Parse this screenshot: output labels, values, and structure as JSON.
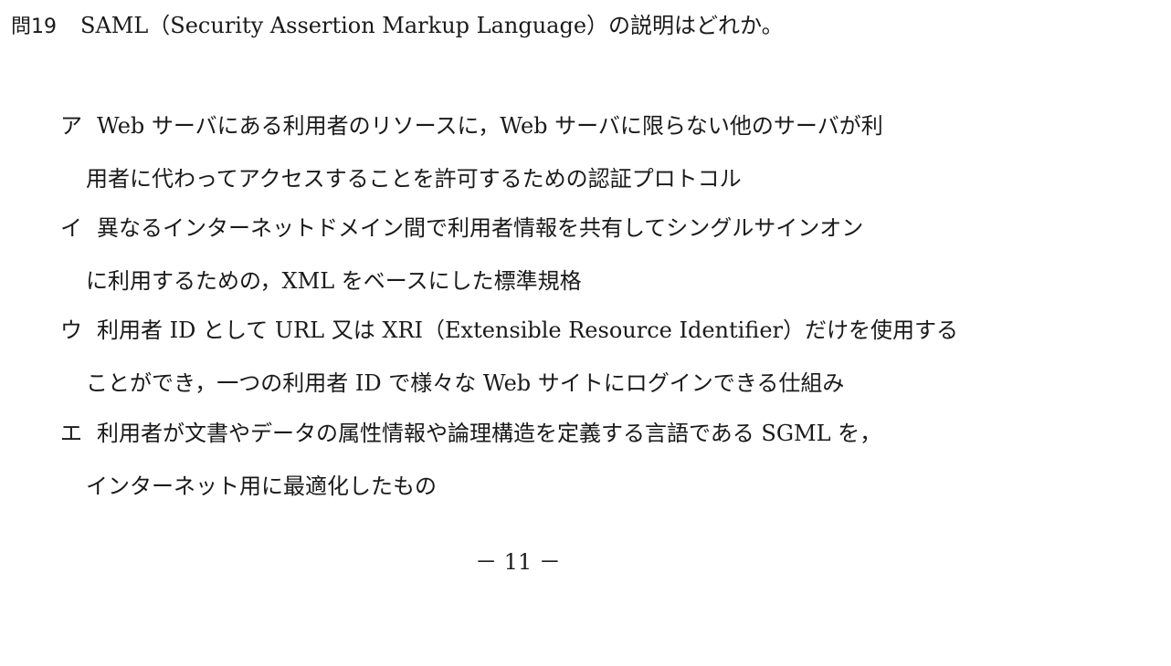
{
  "question": {
    "number": "問19",
    "text": "SAML（Security Assertion Markup Language）の説明はどれか。"
  },
  "choices": [
    {
      "marker": "ア",
      "line1": "Web サーバにある利用者のリソースに，Web サーバに限らない他のサーバが利",
      "line2": "用者に代わってアクセスすることを許可するための認証プロトコル"
    },
    {
      "marker": "イ",
      "line1": "異なるインターネットドメイン間で利用者情報を共有してシングルサインオン",
      "line2": "に利用するための，XML をベースにした標準規格"
    },
    {
      "marker": "ウ",
      "line1": "利用者 ID として URL 又は XRI（Extensible Resource Identifier）だけを使用する",
      "line2": "ことができ，一つの利用者 ID で様々な Web サイトにログインできる仕組み"
    },
    {
      "marker": "エ",
      "line1": "利用者が文書やデータの属性情報や論理構造を定義する言語である SGML を，",
      "line2": "インターネット用に最適化したもの"
    }
  ],
  "page_number": "－ 11 －"
}
